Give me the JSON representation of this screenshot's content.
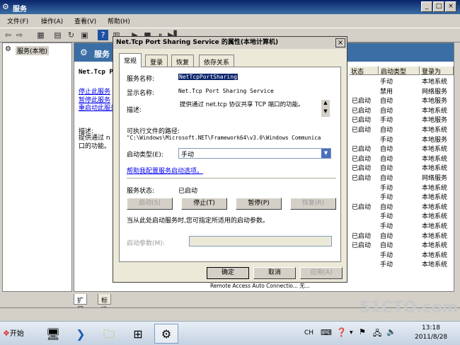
{
  "window": {
    "title": "服务",
    "caption_buttons": [
      "_",
      "□",
      "×"
    ]
  },
  "menu": [
    "文件(F)",
    "操作(A)",
    "查看(V)",
    "帮助(H)"
  ],
  "tree": {
    "root": "服务(本地)"
  },
  "main": {
    "header": "服务",
    "service_short": "Net.Tcp P",
    "links": [
      "停止此服务",
      "暂停此服务",
      "重启动此服务"
    ],
    "desc_label": "描述:",
    "desc_text": "提供通过 n 口的功能。",
    "columns": [
      "状态",
      "启动类型",
      "登录为"
    ],
    "rows": [
      {
        "status": "",
        "startup": "手动",
        "logon": "本地系统"
      },
      {
        "status": "",
        "startup": "禁用",
        "logon": "网络服务"
      },
      {
        "status": "已启动",
        "startup": "自动",
        "logon": "本地服务"
      },
      {
        "status": "已启动",
        "startup": "自动",
        "logon": "本地系统"
      },
      {
        "status": "已启动",
        "startup": "手动",
        "logon": "本地服务"
      },
      {
        "status": "已启动",
        "startup": "自动",
        "logon": "本地系统"
      },
      {
        "status": "",
        "startup": "手动",
        "logon": "本地服务"
      },
      {
        "status": "已启动",
        "startup": "自动",
        "logon": "本地系统"
      },
      {
        "status": "已启动",
        "startup": "自动",
        "logon": "本地系统"
      },
      {
        "status": "已启动",
        "startup": "自动",
        "logon": "本地系统"
      },
      {
        "status": "已启动",
        "startup": "自动",
        "logon": "网络服务"
      },
      {
        "status": "",
        "startup": "手动",
        "logon": "本地系统"
      },
      {
        "status": "",
        "startup": "手动",
        "logon": "本地系统"
      },
      {
        "status": "已启动",
        "startup": "自动",
        "logon": "本地系统"
      },
      {
        "status": "",
        "startup": "手动",
        "logon": "本地系统"
      },
      {
        "status": "",
        "startup": "手动",
        "logon": "本地系统"
      },
      {
        "status": "已启动",
        "startup": "自动",
        "logon": "本地系统"
      },
      {
        "status": "已启动",
        "startup": "自动",
        "logon": "本地系统"
      },
      {
        "status": "",
        "startup": "手动",
        "logon": "本地系统"
      },
      {
        "status": "",
        "startup": "手动",
        "logon": "本地系统"
      }
    ],
    "bottom_row": "Remote Access Auto Connectio... 无..."
  },
  "tabs": [
    "扩展",
    "标准"
  ],
  "dialog": {
    "title": "Net.Tcp Port Sharing Service 的属性(本地计算机)",
    "tabs": [
      "常规",
      "登录",
      "恢复",
      "依存关系"
    ],
    "service_name_label": "服务名称:",
    "service_name": "NetTcpPortSharing",
    "display_name_label": "显示名称:",
    "display_name": "Net.Tcp Port Sharing Service",
    "description_label": "描述:",
    "description": "提供通过 net.tcp 协议共享 TCP 端口的功能。",
    "path_label": "可执行文件的路径:",
    "path": "\"C:\\Windows\\Microsoft.NET\\Framework64\\v3.0\\Windows Communica",
    "startup_label": "启动类型(E):",
    "startup_value": "手动",
    "help_link": "帮助我配置服务启动选项。",
    "status_label": "服务状态:",
    "status_value": "已启动",
    "buttons": {
      "start": "启动(S)",
      "stop": "停止(T)",
      "pause": "暂停(P)",
      "resume": "恢复(R)"
    },
    "hint": "当从此处启动服务时,您可指定所适用的启动参数。",
    "params_label": "启动参数(M):",
    "ok": "确定",
    "cancel": "取消",
    "apply": "应用(A)"
  },
  "taskbar": {
    "start": "开始",
    "lang": "CH",
    "time": "13:18",
    "date": "2011/8/28"
  },
  "watermark": "51CTO.com"
}
